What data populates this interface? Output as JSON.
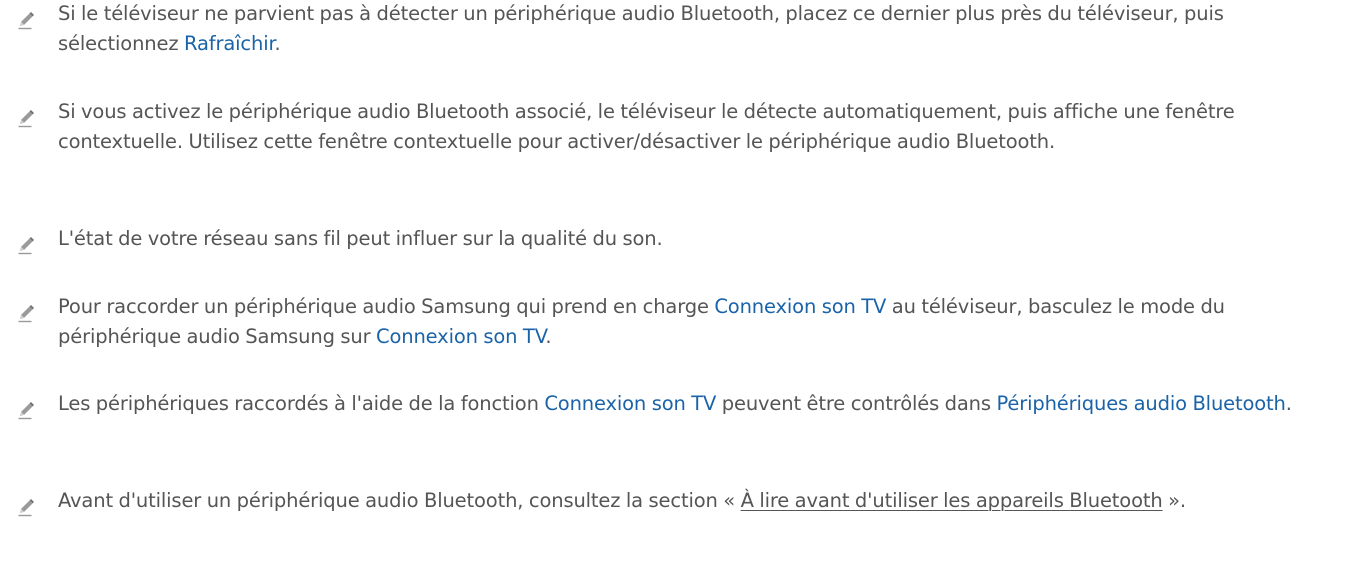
{
  "notes": [
    {
      "parts": [
        {
          "text": "Si le téléviseur ne parvient pas à détecter un périphérique audio Bluetooth, placez ce dernier plus près du téléviseur, puis sélectionnez "
        },
        {
          "text": "Rafraîchir",
          "style": "highlight"
        },
        {
          "text": "."
        }
      ]
    },
    {
      "parts": [
        {
          "text": "Si vous activez le périphérique audio Bluetooth associé, le téléviseur le détecte automatiquement, puis affiche une fenêtre contextuelle. Utilisez cette fenêtre contextuelle pour activer/désactiver le périphérique audio Bluetooth."
        }
      ]
    },
    {
      "parts": [
        {
          "text": "L'état de votre réseau sans fil peut influer sur la qualité du son."
        }
      ]
    },
    {
      "parts": [
        {
          "text": "Pour raccorder un périphérique audio Samsung qui prend en charge "
        },
        {
          "text": "Connexion son TV",
          "style": "highlight"
        },
        {
          "text": " au téléviseur, basculez le mode du périphérique audio Samsung sur "
        },
        {
          "text": "Connexion son TV",
          "style": "highlight"
        },
        {
          "text": "."
        }
      ]
    },
    {
      "parts": [
        {
          "text": "Les périphériques raccordés à l'aide de la fonction "
        },
        {
          "text": "Connexion son TV",
          "style": "highlight"
        },
        {
          "text": " peuvent être contrôlés dans "
        },
        {
          "text": "Périphériques audio Bluetooth",
          "style": "highlight"
        },
        {
          "text": "."
        }
      ]
    },
    {
      "parts": [
        {
          "text": "Avant d'utiliser un périphérique audio Bluetooth, consultez la section « "
        },
        {
          "text": "À lire avant d'utiliser les appareils Bluetooth",
          "style": "link"
        },
        {
          "text": " »."
        }
      ]
    }
  ],
  "icon": "pencil-note-icon",
  "colors": {
    "body_text": "#555555",
    "highlight": "#1a63a8",
    "icon": "#8a8a8a"
  }
}
